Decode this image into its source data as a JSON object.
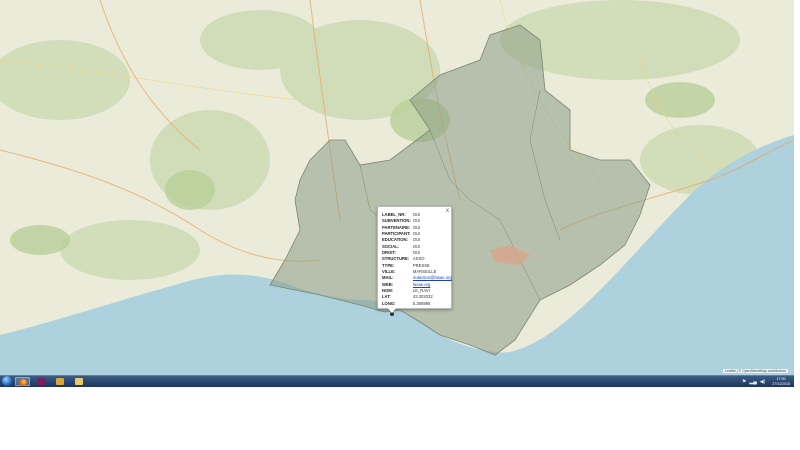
{
  "map": {
    "region_fill": "#8c9c86",
    "sea_color": "#aed1de",
    "land_color": "#eaecd9",
    "attribution": "Leaflet | © OpenStreetMap contributors"
  },
  "popup": {
    "close_label": "x",
    "rows": [
      {
        "k": "LABEL_NR:",
        "v": "OUI"
      },
      {
        "k": "SUBVENTION:",
        "v": "OUI"
      },
      {
        "k": "PARTENAIRE:",
        "v": "OUI"
      },
      {
        "k": "PARTICIPANT:",
        "v": "OUI"
      },
      {
        "k": "EDUCATION:",
        "v": "OUI"
      },
      {
        "k": "SOCIAL:",
        "v": "OUI"
      },
      {
        "k": "DROIT:",
        "v": "OUI"
      },
      {
        "k": "STRUCTURE:",
        "v": "ASSO"
      },
      {
        "k": "TYPE:",
        "v": "PRESSE"
      },
      {
        "k": "VILLE:",
        "v": "MARSEILLE"
      },
      {
        "k": "MAIL:",
        "v": "redaction@fasae.org",
        "link": true
      },
      {
        "k": "WEB:",
        "v": "fasae.org",
        "link": true
      },
      {
        "k": "NOM:",
        "v": "LE_RAVI"
      },
      {
        "k": "LAT:",
        "v": "43.302032"
      },
      {
        "k": "LONG:",
        "v": "5.368995"
      }
    ]
  },
  "taskbar": {
    "apps": [
      {
        "name": "firefox",
        "icon": "firefox-icon"
      },
      {
        "name": "toolbox",
        "icon": "magenta-app-icon"
      },
      {
        "name": "media",
        "icon": "media-player-icon"
      },
      {
        "name": "explorer",
        "icon": "folder-icon"
      }
    ],
    "clock_time": "17:00",
    "clock_date": "27/11/2016"
  }
}
